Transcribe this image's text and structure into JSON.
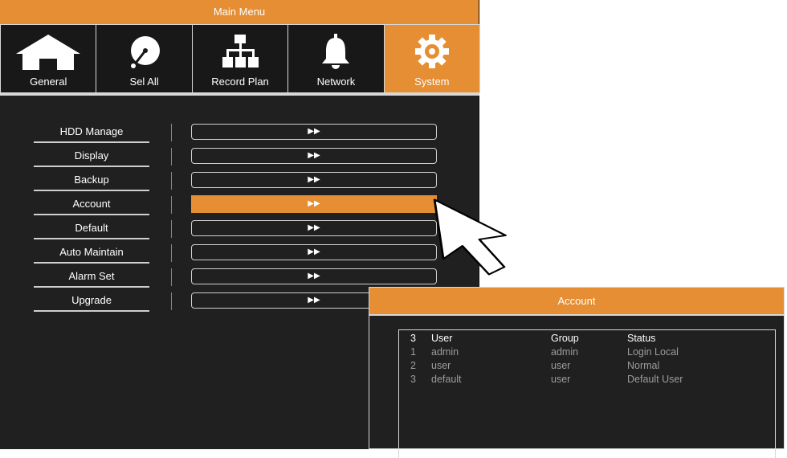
{
  "main_menu": {
    "title": "Main Menu",
    "tabs": [
      {
        "label": "General",
        "icon": "home-icon"
      },
      {
        "label": "Sel All",
        "icon": "disc-icon"
      },
      {
        "label": "Record Plan",
        "icon": "network-tree-icon"
      },
      {
        "label": "Network",
        "icon": "bell-icon"
      },
      {
        "label": "System",
        "icon": "gear-icon",
        "active": true
      }
    ],
    "items": [
      {
        "label": "HDD Manage",
        "button": "▶▶"
      },
      {
        "label": "Display",
        "button": "▶▶"
      },
      {
        "label": "Backup",
        "button": "▶▶"
      },
      {
        "label": "Account",
        "button": "▶▶",
        "active": true
      },
      {
        "label": "Default",
        "button": "▶▶"
      },
      {
        "label": "Auto Maintain",
        "button": "▶▶"
      },
      {
        "label": "Alarm Set",
        "button": "▶▶"
      },
      {
        "label": "Upgrade",
        "button": "▶▶"
      }
    ]
  },
  "account": {
    "title": "Account",
    "header": {
      "num": "3",
      "user": "User",
      "group": "Group",
      "status": "Status"
    },
    "rows": [
      {
        "num": "1",
        "user": "admin",
        "group": "admin",
        "status": "Login Local"
      },
      {
        "num": "2",
        "user": "user",
        "group": "user",
        "status": "Normal"
      },
      {
        "num": "3",
        "user": "default",
        "group": "user",
        "status": "Default User"
      }
    ]
  },
  "colors": {
    "accent": "#e58e33",
    "panel": "#202020",
    "text": "#ffffff",
    "muted": "#9c9c9c"
  }
}
